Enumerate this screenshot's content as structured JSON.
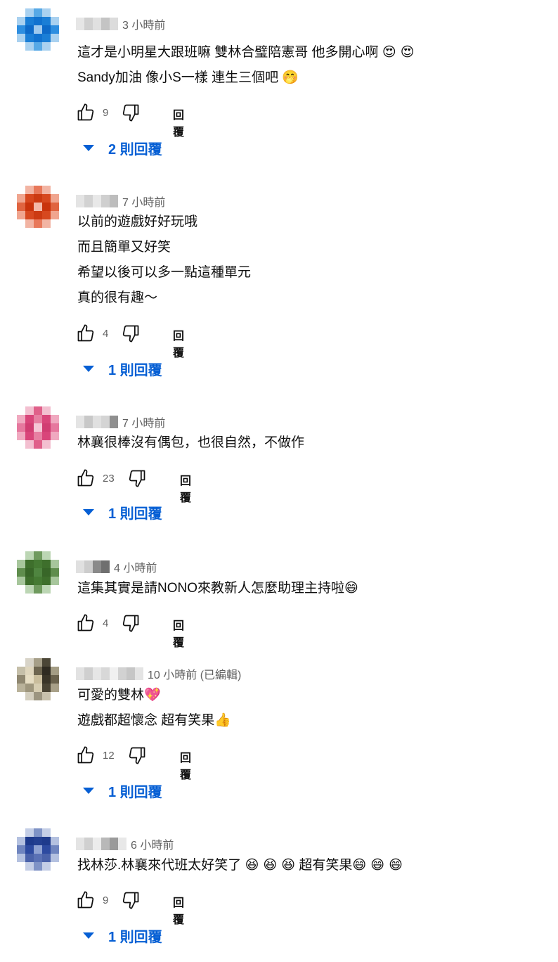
{
  "labels": {
    "reply": "回覆"
  },
  "colors": {
    "link": "#065fd4",
    "meta": "#606060"
  },
  "comments": [
    {
      "time": "3 小時前",
      "lines": [
        {
          "text": "這才是小明星大跟班嘛 雙林合璧陪憲哥 他多開心啊 ",
          "emoji": "😍 😍"
        },
        {
          "text": "Sandy加油 像小S一樣 連生三個吧 ",
          "emoji": "🤭"
        }
      ],
      "likes": "9",
      "replies_label": "2 則回覆"
    },
    {
      "time": "7 小時前",
      "lines": [
        {
          "text": "以前的遊戲好好玩哦",
          "emoji": ""
        },
        {
          "text": "而且簡單又好笑",
          "emoji": ""
        },
        {
          "text": "希望以後可以多一點這種單元",
          "emoji": ""
        },
        {
          "text": "真的很有趣～",
          "emoji": ""
        }
      ],
      "likes": "4",
      "replies_label": "1 則回覆"
    },
    {
      "time": "7 小時前",
      "lines": [
        {
          "text": "林襄很棒沒有偶包，也很自然，不做作",
          "emoji": ""
        }
      ],
      "likes": "23",
      "replies_label": "1 則回覆"
    },
    {
      "time": "4 小時前",
      "lines": [
        {
          "text": "這集其實是請NONO來教新人怎麼助理主持啦",
          "emoji": "😄"
        }
      ],
      "likes": "4",
      "replies_label": ""
    },
    {
      "time": "10 小時前 (已編輯)",
      "lines": [
        {
          "text": "可愛的雙林",
          "emoji": "💖"
        },
        {
          "text": " 遊戲都超懷念 超有笑果",
          "emoji": "👍"
        }
      ],
      "likes": "12",
      "replies_label": "1 則回覆"
    },
    {
      "time": "6 小時前",
      "lines": [
        {
          "text": "找林莎.林襄來代班太好笑了",
          "emoji": "😆 😆 😆"
        },
        {
          "text": "超有笑果",
          "emoji": "😄 😄 😄"
        }
      ],
      "likes": "9",
      "replies_label": "1 則回覆"
    }
  ]
}
